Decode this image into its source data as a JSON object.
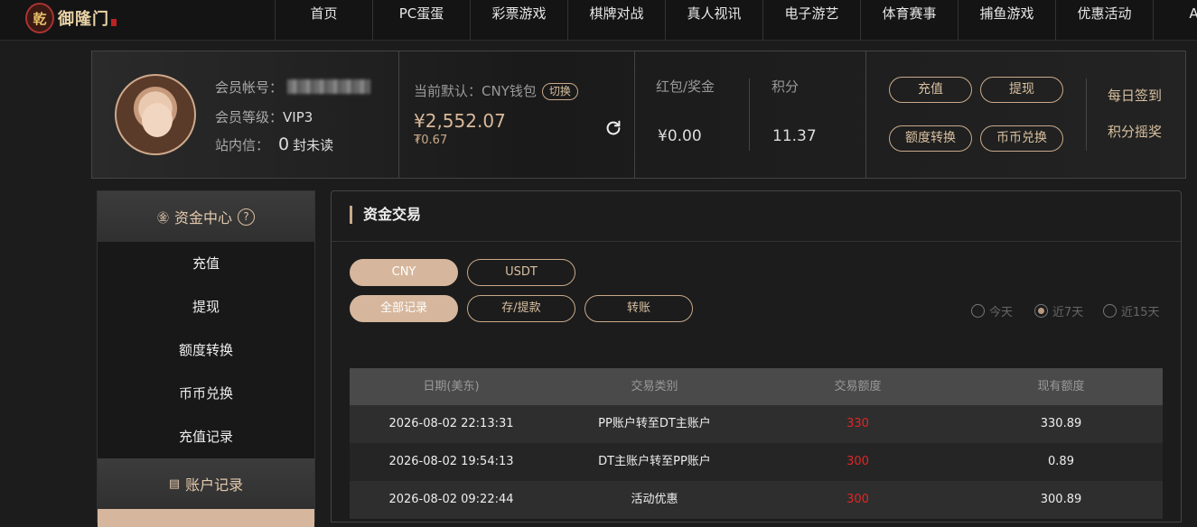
{
  "logo": {
    "text": "御隆门"
  },
  "nav": [
    "首页",
    "PC蛋蛋",
    "彩票游戏",
    "棋牌对战",
    "真人视讯",
    "电子游艺",
    "体育赛事",
    "捕鱼游戏",
    "优惠活动",
    "APP"
  ],
  "account": {
    "username_label": "会员帐号：",
    "level_label": "会员等级：",
    "level_value": "VIP3",
    "inbox_label": "站内信：",
    "inbox_count": "0",
    "inbox_suffix": "封未读",
    "wallet_label": "当前默认：CNY钱包",
    "switch_label": "切换",
    "wallet_amount": "¥2,552.07",
    "wallet_sub": "₮0.67",
    "redpacket_label": "红包/奖金",
    "redpacket_value": "¥0.00",
    "points_label": "积分",
    "points_value": "11.37",
    "btn_deposit": "充值",
    "btn_withdraw": "提现",
    "btn_transfer": "额度转换",
    "btn_exchange": "币币兑换",
    "link_signin": "每日签到",
    "link_lottery": "积分摇奖"
  },
  "sidebar": {
    "section1_title": "资金中心",
    "items": [
      "充值",
      "提现",
      "额度转换",
      "币币兑换",
      "充值记录"
    ],
    "section2_title": "账户记录"
  },
  "main": {
    "title": "资金交易",
    "currency_tabs": [
      "CNY",
      "USDT"
    ],
    "type_tabs": [
      "全部记录",
      "存/提款",
      "转账"
    ],
    "range_options": [
      "今天",
      "近7天",
      "近15天"
    ],
    "range_selected": "近7天",
    "columns": [
      "日期(美东)",
      "交易类别",
      "交易额度",
      "现有额度"
    ],
    "rows": [
      {
        "date": "2026-08-02 22:13:31",
        "type": "PP账户转至DT主账户",
        "amount": "330",
        "balance": "330.89"
      },
      {
        "date": "2026-08-02 19:54:13",
        "type": "DT主账户转至PP账户",
        "amount": "300",
        "balance": "0.89"
      },
      {
        "date": "2026-08-02 09:22:44",
        "type": "活动优惠",
        "amount": "300",
        "balance": "300.89"
      }
    ]
  },
  "colors": {
    "accent": "#d6b79d",
    "negative": "#e02626"
  }
}
